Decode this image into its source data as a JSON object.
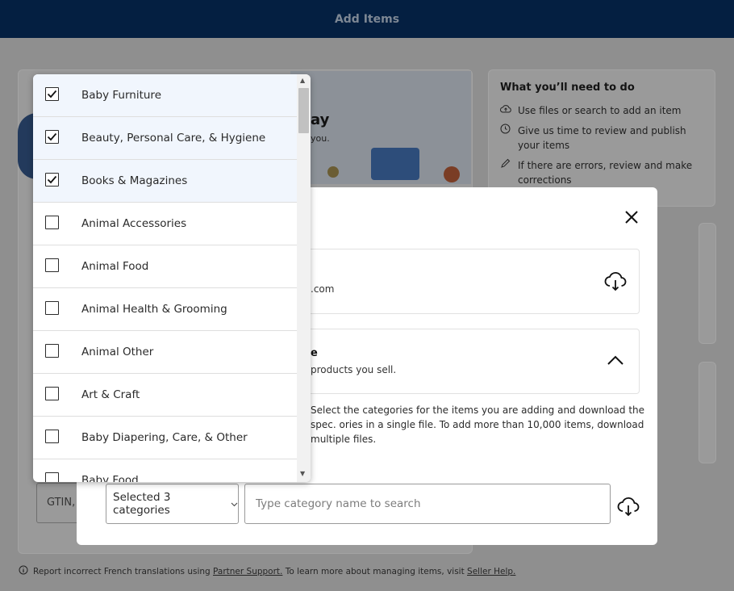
{
  "header": {
    "title": "Add Items"
  },
  "background": {
    "hero_title": "ay",
    "hero_sub": "you.",
    "side": {
      "heading": "What you’ll need to do",
      "steps": [
        {
          "icon": "cloud-upload-icon",
          "text": "Use files or search to add an item"
        },
        {
          "icon": "clock-icon",
          "text": "Give us time to review and publish your items"
        },
        {
          "icon": "pencil-icon",
          "text": "If there are errors, review and make corrections"
        }
      ]
    },
    "gtin_label": "GTIN,",
    "footer": {
      "text_before": "Report incorrect French translations using ",
      "link1": "Partner Support.",
      "text_middle": " To learn more about managing items, visit ",
      "link2": "Seller Help."
    }
  },
  "modal": {
    "option1": {
      "subtitle": ".com",
      "icon": "cloud-download-icon"
    },
    "option2": {
      "title": "e",
      "subtitle": "products you sell.",
      "icon": "chevron-up-icon"
    },
    "description": "Select the categories for the items you are adding and download the spec. ories in a single file. To add more than 10,000 items, download multiple files.",
    "category_select": {
      "label": "Selected 3 categories"
    },
    "search": {
      "placeholder": "Type category name to search",
      "value": ""
    },
    "download_icon": "cloud-download-icon"
  },
  "dropdown": {
    "items": [
      {
        "label": "Baby Furniture",
        "checked": true
      },
      {
        "label": "Beauty, Personal Care, & Hygiene",
        "checked": true
      },
      {
        "label": "Books & Magazines",
        "checked": true
      },
      {
        "label": "Animal Accessories",
        "checked": false
      },
      {
        "label": "Animal Food",
        "checked": false
      },
      {
        "label": "Animal Health & Grooming",
        "checked": false
      },
      {
        "label": "Animal Other",
        "checked": false
      },
      {
        "label": "Art & Craft",
        "checked": false
      },
      {
        "label": "Baby Diapering, Care, & Other",
        "checked": false
      },
      {
        "label": "Baby Food",
        "checked": false
      }
    ]
  },
  "colors": {
    "header_bg": "#041f41",
    "selected_row_bg": "#f1f6fd",
    "overlay": "#8f8f8f"
  }
}
